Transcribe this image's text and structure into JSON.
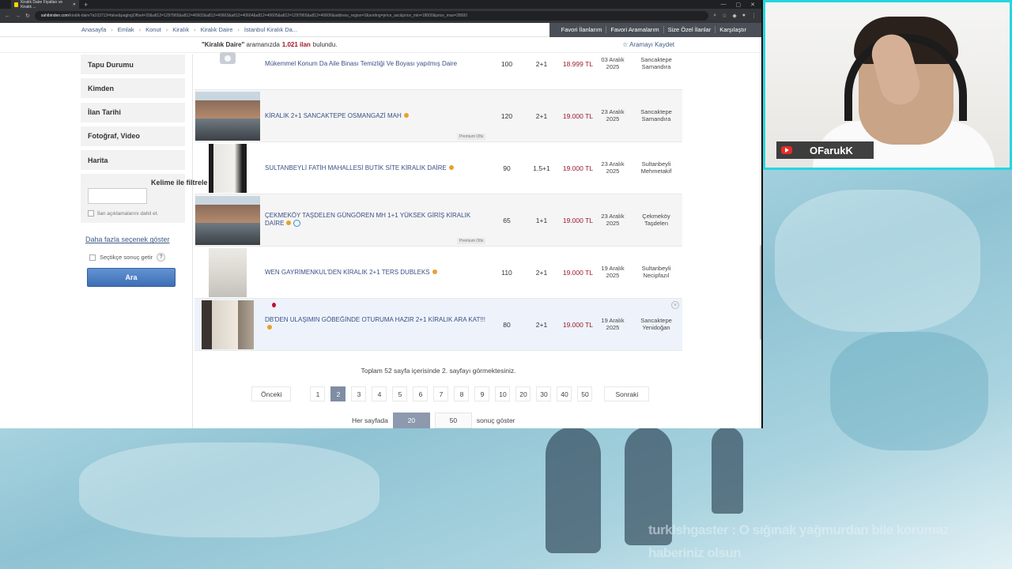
{
  "browser": {
    "tab_title": "Kiralık Daire Fiyatları ve Kiralık ...",
    "url_host": "sahibinden.com",
    "url_path": "/kiralik-daire?a103713=false&pagingOffset=20&a812=1297865&a812=40602&a812=40603&a812=40604&a812=40605&a812=1297865&a812=40606&address_region=2&sorting=price_asc&price_min=18000&price_max=28000"
  },
  "breadcrumb": [
    "Anasayfa",
    "Emlak",
    "Konut",
    "Kiralık",
    "Kiralık Daire",
    "İstanbul Kiralık Da..."
  ],
  "topnav": [
    "Favori İlanlarım",
    "Favori Aramalarım",
    "Size Özel İlanlar",
    "Karşılaştır"
  ],
  "search_summary": {
    "query": "\"Kiralık Daire\"",
    "middle": "aramanızda",
    "count": "1.021 ilan",
    "suffix": "bulundu.",
    "save_label": "Aramayı Kaydet"
  },
  "sidebar": {
    "items": [
      "Tapu Durumu",
      "Kimden",
      "İlan Tarihi",
      "Fotoğraf, Video",
      "Harita"
    ],
    "keyword_title": "Kelime ile filtrele",
    "keyword_placeholder": "",
    "desc_checkbox": "İlan açıklamalarını dahil et.",
    "more_link": "Daha fazla seçenek göster",
    "stepwise": "Seçtikçe sonuç getir",
    "help": "?",
    "search_button": "Ara"
  },
  "listings": [
    {
      "title": "Mükemmel Konum Da Aile Binası Temizliği Ve Boyası yapılmış Daire",
      "m2": "100",
      "rooms": "2+1",
      "price": "18.999 TL",
      "date1": "03 Aralık",
      "date2": "2025",
      "loc1": "Sancaktepe",
      "loc2": "Samandıra",
      "photo": "none",
      "premium": ""
    },
    {
      "title": "KİRALIK 2+1 SANCAKTEPE OSMANGAZİ MAH",
      "m2": "120",
      "rooms": "2+1",
      "price": "19.000 TL",
      "date1": "23 Aralık",
      "date2": "2025",
      "loc1": "Sancaktepe",
      "loc2": "Samandıra",
      "photo": "building",
      "premium": "Premium Ofis"
    },
    {
      "title": "SULTANBEYLİ FATİH MAHALLESİ BUTİK SİTE KİRALIK DAİRE",
      "m2": "90",
      "rooms": "1.5+1",
      "price": "19.000 TL",
      "date1": "23 Aralık",
      "date2": "2025",
      "loc1": "Sultanbeyli",
      "loc2": "Mehmetakif",
      "photo": "kitchen",
      "premium": ""
    },
    {
      "title": "ÇEKMEKÖY TAŞDELEN GÜNGÖREN MH 1+1 YÜKSEK GİRİŞ KİRALIK DAİRE",
      "m2": "65",
      "rooms": "1+1",
      "price": "19.000 TL",
      "date1": "23 Aralık",
      "date2": "2025",
      "loc1": "Çekmeköy",
      "loc2": "Taşdelen",
      "photo": "building",
      "premium": "Premium Ofis"
    },
    {
      "title": "WEN GAYRİMENKUL'DEN KİRALIK 2+1 TERS DUBLEKS",
      "m2": "110",
      "rooms": "2+1",
      "price": "19.000 TL",
      "date1": "19 Aralık",
      "date2": "2025",
      "loc1": "Sultanbeyli",
      "loc2": "Necipfazıl",
      "photo": "room",
      "premium": ""
    },
    {
      "title": "DB'DEN ULAŞIMIN GÖBEĞİNDE OTURUMA HAZIR 2+1 KİRALIK ARA KAT!!!",
      "m2": "80",
      "rooms": "2+1",
      "price": "19.000 TL",
      "date1": "19 Aralık",
      "date2": "2025",
      "loc1": "Sancaktepe",
      "loc2": "Yenidoğan",
      "photo": "interior",
      "premium": ""
    }
  ],
  "pagination": {
    "info": "Toplam 52 sayfa içerisinde 2. sayfayı görmektesiniz.",
    "prev": "Önceki",
    "pages": [
      "1",
      "2",
      "3",
      "4",
      "5",
      "6",
      "7",
      "8",
      "9",
      "10",
      "20",
      "30",
      "40",
      "50"
    ],
    "active": "2",
    "next": "Sonraki",
    "per_page_label": "Her sayfada",
    "per_page_options": [
      "20",
      "50"
    ],
    "per_page_active": "20",
    "per_page_suffix": "sonuç göster"
  },
  "stream": {
    "channel": "OFarukK",
    "chat_line1": "turklshgaster : O sığınak yağmurdan bile korumaz",
    "chat_line2": "haberiniz olsun"
  },
  "colors": {
    "price": "#9a1b2c",
    "link": "#3a4f85",
    "webcam_border": "#25d6e0",
    "active_page": "#7f8da3",
    "search_button": "#3e6fb5"
  }
}
